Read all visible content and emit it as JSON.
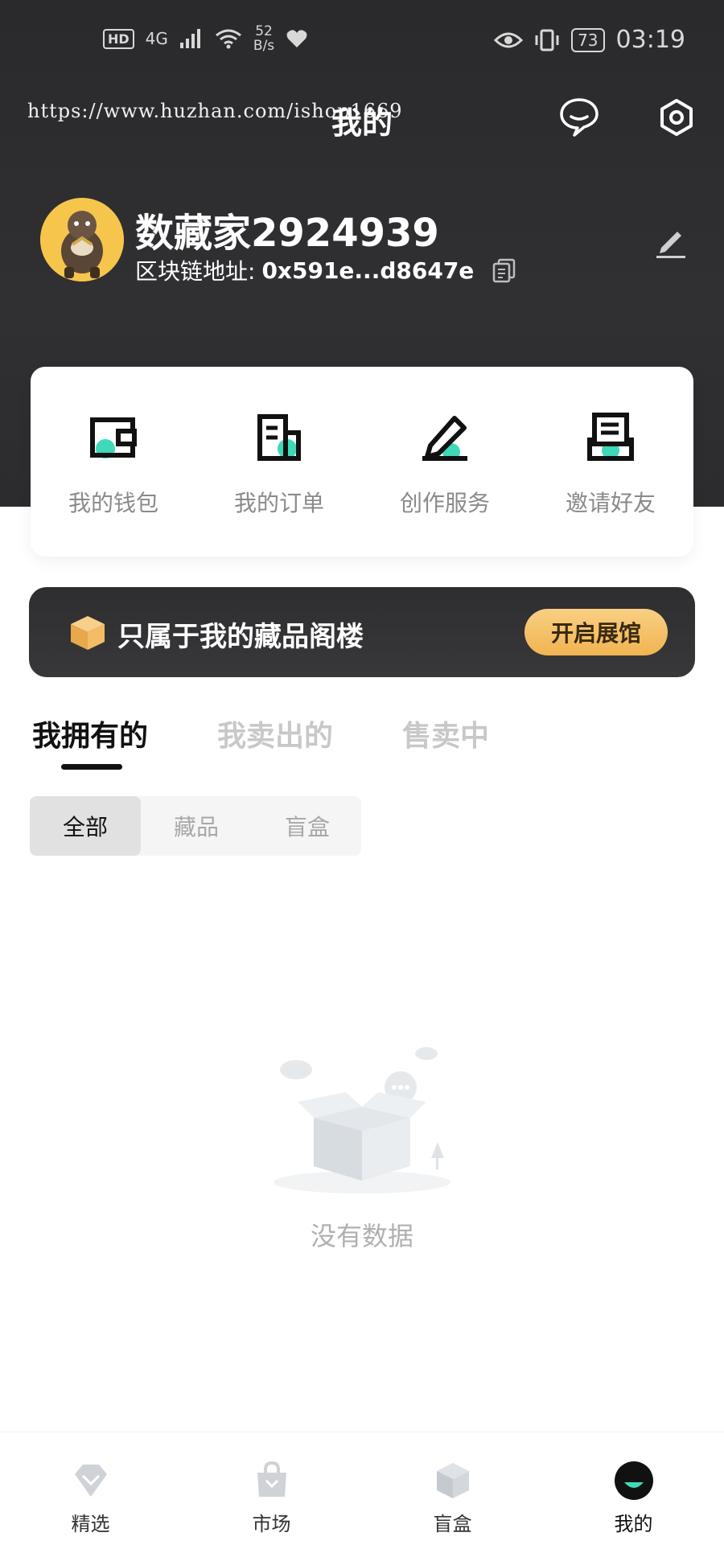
{
  "status_bar": {
    "hd": "HD",
    "network": "4G",
    "speed_value": "52",
    "speed_unit": "B/s",
    "battery": "73",
    "time": "03:19"
  },
  "watermark": "https://www.huzhan.com/ishop1669",
  "header": {
    "title": "我的"
  },
  "profile": {
    "username": "数藏家2924939",
    "address_label": "区块链地址:",
    "address_value": "0x591e...d8647e"
  },
  "quick_actions": [
    {
      "label": "我的钱包",
      "icon": "wallet-icon"
    },
    {
      "label": "我的订单",
      "icon": "order-icon"
    },
    {
      "label": "创作服务",
      "icon": "pen-icon"
    },
    {
      "label": "邀请好友",
      "icon": "invite-icon"
    }
  ],
  "banner": {
    "text": "只属于我的藏品阁楼",
    "button_label": "开启展馆"
  },
  "tabs": [
    {
      "label": "我拥有的",
      "active": true
    },
    {
      "label": "我卖出的",
      "active": false
    },
    {
      "label": "售卖中",
      "active": false
    }
  ],
  "filters": [
    {
      "label": "全部",
      "active": true
    },
    {
      "label": "藏品",
      "active": false
    },
    {
      "label": "盲盒",
      "active": false
    }
  ],
  "empty_state": {
    "text": "没有数据"
  },
  "bottom_nav": [
    {
      "label": "精选",
      "icon": "gem-icon",
      "active": false
    },
    {
      "label": "市场",
      "icon": "shopping-bag-icon",
      "active": false
    },
    {
      "label": "盲盒",
      "icon": "blind-box-icon",
      "active": false
    },
    {
      "label": "我的",
      "icon": "profile-face-icon",
      "active": true
    }
  ],
  "colors": {
    "accent_teal": "#3fd9b9",
    "header_dark": "#2c2c2e",
    "gold": "#f1b451"
  }
}
